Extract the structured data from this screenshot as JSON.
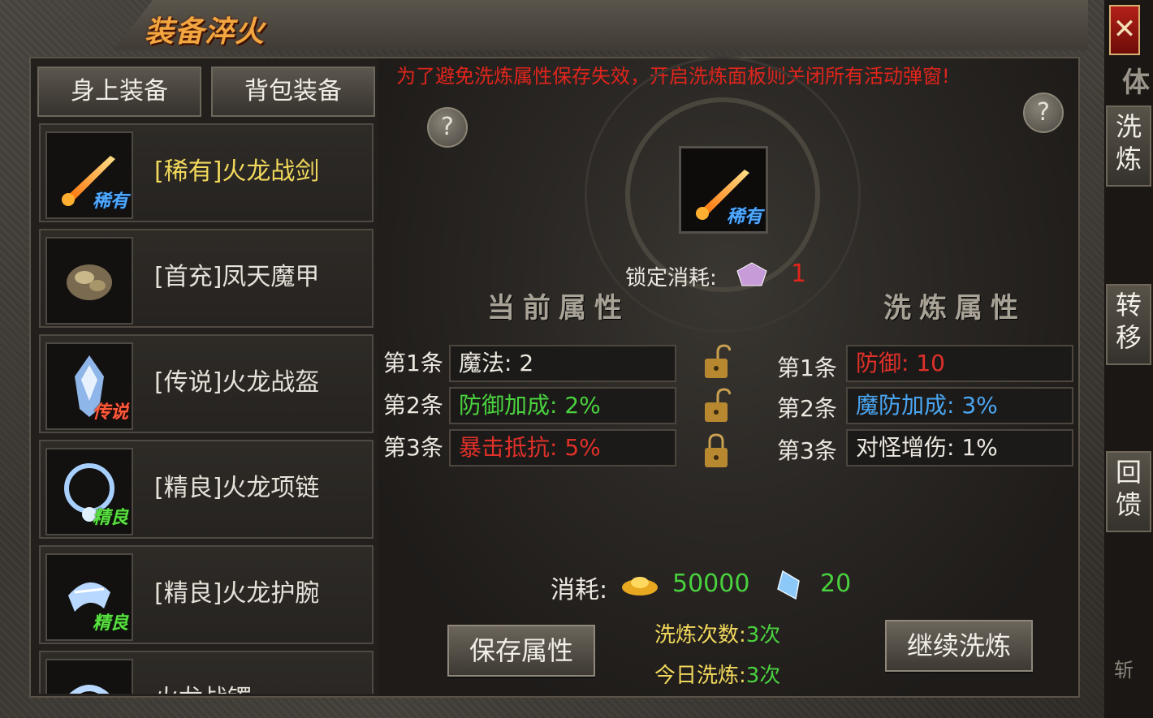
{
  "title": "装备淬火",
  "close_label": "✕",
  "tabs": [
    "身上装备",
    "背包装备"
  ],
  "notice": "为了避免洗炼属性保存失效，开启洗炼面板则关闭所有活动弹窗!",
  "help_label": "?",
  "equipment": [
    {
      "name": "[稀有]火龙战剑",
      "badge": "稀有"
    },
    {
      "name": "[首充]凤天魔甲",
      "badge": ""
    },
    {
      "name": "[传说]火龙战盔",
      "badge": "传说"
    },
    {
      "name": "[精良]火龙项链",
      "badge": "精良"
    },
    {
      "name": "[精良]火龙护腕",
      "badge": "精良"
    },
    {
      "name": "火龙战镯",
      "badge": ""
    }
  ],
  "selected_badge": "稀有",
  "lock_cost_label": "锁定消耗:",
  "lock_cost_value": "1",
  "current_title": "当前属性",
  "refine_title": "洗炼属性",
  "row_labels": [
    "第1条",
    "第2条",
    "第3条"
  ],
  "current_attrs": [
    {
      "text": "魔法: 2",
      "color": "white"
    },
    {
      "text": "防御加成: 2%",
      "color": "green"
    },
    {
      "text": "暴击抵抗: 5%",
      "color": "red"
    }
  ],
  "refine_attrs": [
    {
      "text": "防御: 10",
      "color": "red"
    },
    {
      "text": "魔防加成: 3%",
      "color": "blue"
    },
    {
      "text": "对怪增伤: 1%",
      "color": "white"
    }
  ],
  "locks": [
    "unlocked",
    "unlocked",
    "locked"
  ],
  "cost_label": "消耗:",
  "gold_cost": "50000",
  "crystal_cost": "20",
  "save_button": "保存属性",
  "continue_button": "继续洗炼",
  "refine_count_label": "洗炼次数:",
  "refine_count_value": "3次",
  "today_count_label": "今日洗炼:",
  "today_count_value": "3次",
  "side_tabs": [
    "洗炼",
    "转移",
    "回馈"
  ],
  "side_top_text": "体",
  "side_bottom_text": "斩"
}
